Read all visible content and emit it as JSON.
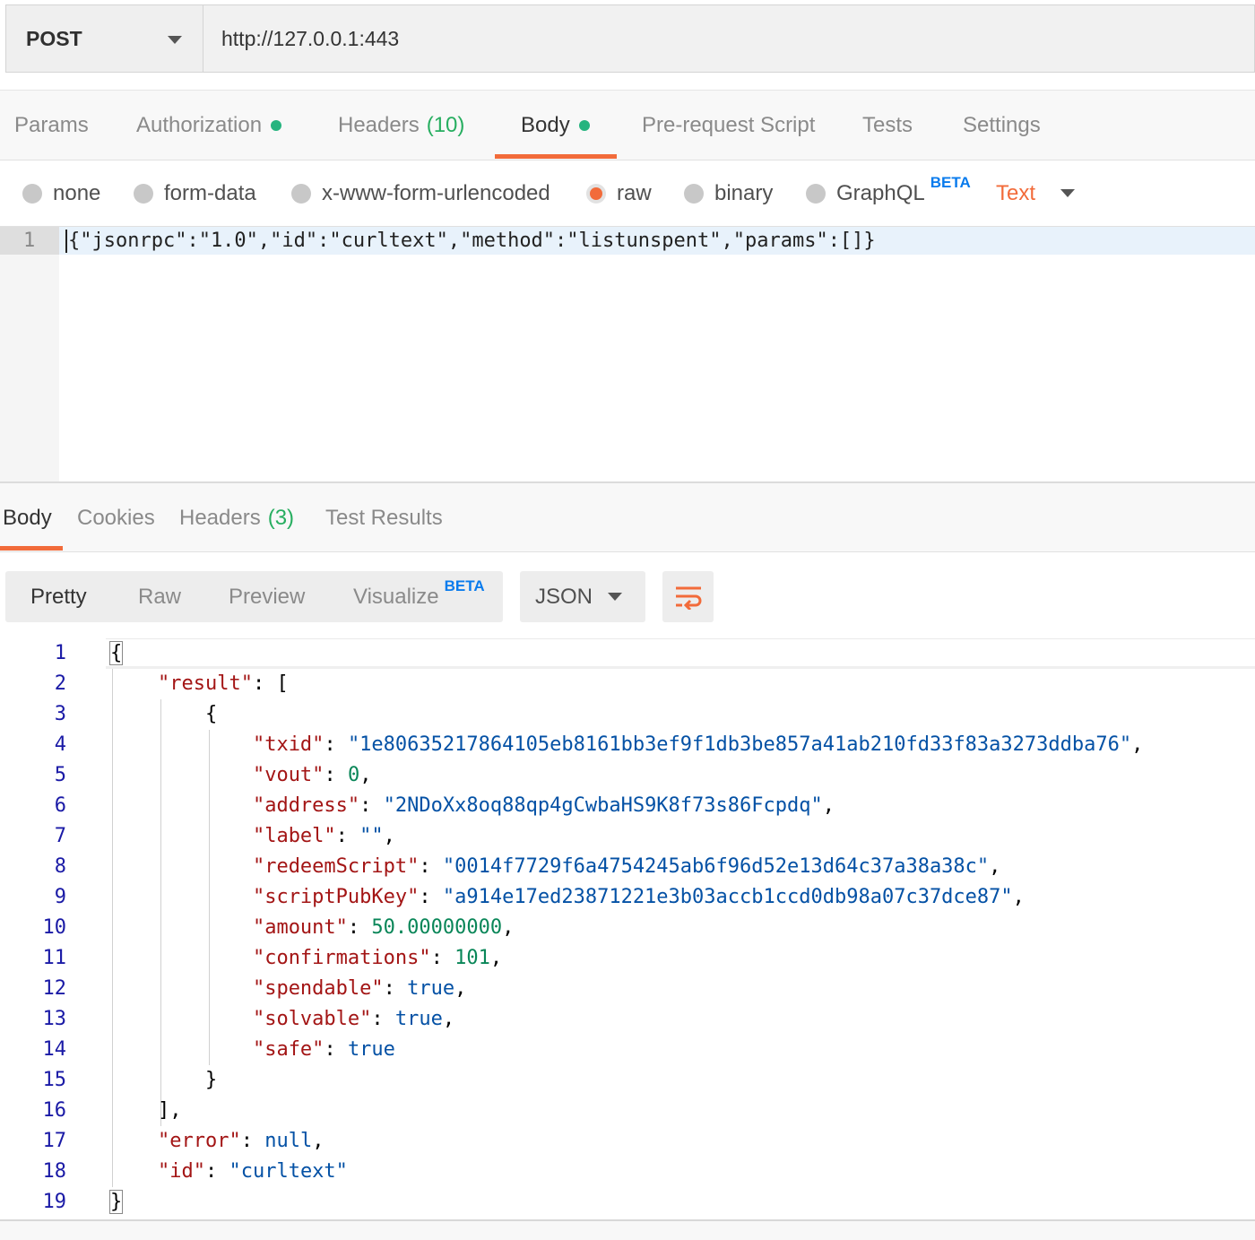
{
  "request": {
    "method": "POST",
    "url": "http://127.0.0.1:443"
  },
  "request_tabs": [
    {
      "label": "Params",
      "count": "",
      "dot": false
    },
    {
      "label": "Authorization",
      "count": "",
      "dot": true
    },
    {
      "label": "Headers",
      "count": "(10)",
      "dot": false
    },
    {
      "label": "Body",
      "count": "",
      "dot": true,
      "active": true
    },
    {
      "label": "Pre-request Script",
      "count": "",
      "dot": false
    },
    {
      "label": "Tests",
      "count": "",
      "dot": false
    },
    {
      "label": "Settings",
      "count": "",
      "dot": false
    }
  ],
  "body_types": {
    "options": [
      "none",
      "form-data",
      "x-www-form-urlencoded",
      "raw",
      "binary",
      "GraphQL"
    ],
    "selected": "raw",
    "graphql_badge": "BETA",
    "format": "Text"
  },
  "request_body": {
    "line_number": "1",
    "code": "{\"jsonrpc\":\"1.0\",\"id\":\"curltext\",\"method\":\"listunspent\",\"params\":[]}"
  },
  "response_tabs": [
    {
      "label": "Body",
      "count": "",
      "active": true
    },
    {
      "label": "Cookies",
      "count": ""
    },
    {
      "label": "Headers",
      "count": "(3)"
    },
    {
      "label": "Test Results",
      "count": ""
    }
  ],
  "view_modes": {
    "options": [
      "Pretty",
      "Raw",
      "Preview",
      "Visualize"
    ],
    "selected": "Pretty",
    "visualize_badge": "BETA",
    "language": "JSON"
  },
  "response_body": {
    "line_numbers": [
      "1",
      "2",
      "3",
      "4",
      "5",
      "6",
      "7",
      "8",
      "9",
      "10",
      "11",
      "12",
      "13",
      "14",
      "15",
      "16",
      "17",
      "18",
      "19"
    ],
    "fields": {
      "result_key": "\"result\"",
      "txid_key": "\"txid\"",
      "txid": "\"1e80635217864105eb8161bb3ef9f1db3be857a41ab210fd33f83a3273ddba76\"",
      "vout_key": "\"vout\"",
      "vout": "0",
      "address_key": "\"address\"",
      "address": "\"2NDoXx8oq88qp4gCwbaHS9K8f73s86Fcpdq\"",
      "label_key": "\"label\"",
      "label": "\"\"",
      "redeemScript_key": "\"redeemScript\"",
      "redeemScript": "\"0014f7729f6a4754245ab6f96d52e13d64c37a38a38c\"",
      "scriptPubKey_key": "\"scriptPubKey\"",
      "scriptPubKey": "\"a914e17ed23871221e3b03accb1ccd0db98a07c37dce87\"",
      "amount_key": "\"amount\"",
      "amount": "50.00000000",
      "confirmations_key": "\"confirmations\"",
      "confirmations": "101",
      "spendable_key": "\"spendable\"",
      "spendable": "true",
      "solvable_key": "\"solvable\"",
      "solvable": "true",
      "safe_key": "\"safe\"",
      "safe": "true",
      "error_key": "\"error\"",
      "error": "null",
      "id_key": "\"id\"",
      "id": "\"curltext\""
    }
  },
  "colors": {
    "accent": "#f26b3a",
    "status_dot": "#26b47f",
    "count_green": "#27ae60",
    "beta_blue": "#097bed",
    "json_key": "#a31515",
    "json_string": "#0451a5",
    "json_number": "#098658"
  },
  "icons": {
    "wrap": "wrap-lines-icon",
    "dropdown": "chevron-down-icon"
  }
}
